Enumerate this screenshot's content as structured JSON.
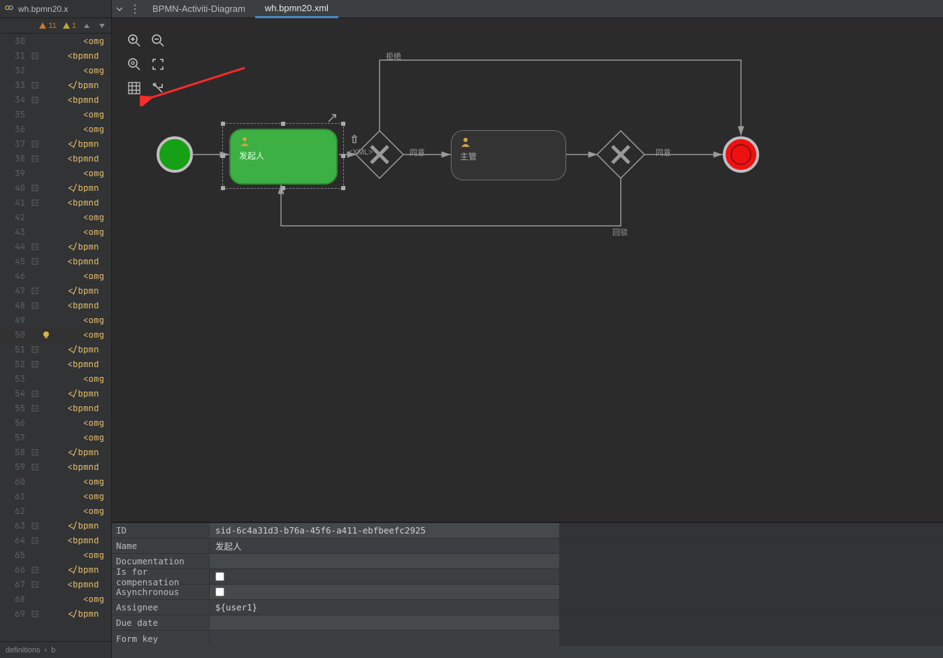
{
  "left_tab": {
    "label": "wh.bpmn20.x"
  },
  "warnings": {
    "major": "11",
    "minor": "1"
  },
  "code_lines": [
    {
      "n": "30",
      "fold": "",
      "txt_kind": "omg-close",
      "txt": "<omg"
    },
    {
      "n": "31",
      "fold": "-",
      "txt_kind": "bpmn-open",
      "txt": "<bpmnd"
    },
    {
      "n": "32",
      "fold": "",
      "txt_kind": "omg-open",
      "txt": "<omg"
    },
    {
      "n": "33",
      "fold": "-",
      "txt_kind": "bpmn-close",
      "txt": "</bpmn"
    },
    {
      "n": "34",
      "fold": "-",
      "txt_kind": "bpmn-open",
      "txt": "<bpmnd"
    },
    {
      "n": "35",
      "fold": "",
      "txt_kind": "omg-open",
      "txt": "<omg"
    },
    {
      "n": "36",
      "fold": "",
      "txt_kind": "omg-open",
      "txt": "<omg"
    },
    {
      "n": "37",
      "fold": "-",
      "txt_kind": "bpmn-close",
      "txt": "</bpmn"
    },
    {
      "n": "38",
      "fold": "-",
      "txt_kind": "bpmn-open",
      "txt": "<bpmnd"
    },
    {
      "n": "39",
      "fold": "",
      "txt_kind": "omg-open",
      "txt": "<omg"
    },
    {
      "n": "40",
      "fold": "-",
      "txt_kind": "bpmn-close",
      "txt": "</bpmn"
    },
    {
      "n": "41",
      "fold": "-",
      "txt_kind": "bpmn-open",
      "txt": "<bpmnd"
    },
    {
      "n": "42",
      "fold": "",
      "txt_kind": "omg-open",
      "txt": "<omg"
    },
    {
      "n": "43",
      "fold": "",
      "txt_kind": "omg-open",
      "txt": "<omg"
    },
    {
      "n": "44",
      "fold": "-",
      "txt_kind": "bpmn-close",
      "txt": "</bpmn"
    },
    {
      "n": "45",
      "fold": "-",
      "txt_kind": "bpmn-open",
      "txt": "<bpmnd"
    },
    {
      "n": "46",
      "fold": "",
      "txt_kind": "omg-open",
      "txt": "<omg"
    },
    {
      "n": "47",
      "fold": "-",
      "txt_kind": "bpmn-close",
      "txt": "</bpmn"
    },
    {
      "n": "48",
      "fold": "-",
      "txt_kind": "bpmn-open",
      "txt": "<bpmnd"
    },
    {
      "n": "49",
      "fold": "",
      "txt_kind": "omg-open",
      "txt": "<omg"
    },
    {
      "n": "50",
      "fold": "",
      "txt_kind": "omg-open",
      "txt": "<omg",
      "bulb": true,
      "hl": true
    },
    {
      "n": "51",
      "fold": "-",
      "txt_kind": "bpmn-close",
      "txt": "</bpmn"
    },
    {
      "n": "52",
      "fold": "-",
      "txt_kind": "bpmn-open",
      "txt": "<bpmnd"
    },
    {
      "n": "53",
      "fold": "",
      "txt_kind": "omg-open",
      "txt": "<omg"
    },
    {
      "n": "54",
      "fold": "-",
      "txt_kind": "bpmn-close",
      "txt": "</bpmn"
    },
    {
      "n": "55",
      "fold": "-",
      "txt_kind": "bpmn-open",
      "txt": "<bpmnd"
    },
    {
      "n": "56",
      "fold": "",
      "txt_kind": "omg-open",
      "txt": "<omg"
    },
    {
      "n": "57",
      "fold": "",
      "txt_kind": "omg-open",
      "txt": "<omg"
    },
    {
      "n": "58",
      "fold": "-",
      "txt_kind": "bpmn-close",
      "txt": "</bpmn"
    },
    {
      "n": "59",
      "fold": "-",
      "txt_kind": "bpmn-open",
      "txt": "<bpmnd"
    },
    {
      "n": "60",
      "fold": "",
      "txt_kind": "omg-open",
      "txt": "<omg"
    },
    {
      "n": "61",
      "fold": "",
      "txt_kind": "omg-open",
      "txt": "<omg"
    },
    {
      "n": "62",
      "fold": "",
      "txt_kind": "omg-open",
      "txt": "<omg"
    },
    {
      "n": "63",
      "fold": "-",
      "txt_kind": "bpmn-close",
      "txt": "</bpmn"
    },
    {
      "n": "64",
      "fold": "-",
      "txt_kind": "bpmn-open",
      "txt": "<bpmnd"
    },
    {
      "n": "65",
      "fold": "",
      "txt_kind": "omg-open",
      "txt": "<omg"
    },
    {
      "n": "66",
      "fold": "-",
      "txt_kind": "bpmn-close",
      "txt": "</bpmn"
    },
    {
      "n": "67",
      "fold": "-",
      "txt_kind": "bpmn-open",
      "txt": "<bpmnd"
    },
    {
      "n": "68",
      "fold": "",
      "txt_kind": "omg-open",
      "txt": "<omg"
    },
    {
      "n": "69",
      "fold": "-",
      "txt_kind": "bpmn-close",
      "txt": "</bpmn"
    }
  ],
  "breadcrumb": {
    "a": "definitions",
    "b": "b"
  },
  "tabs": {
    "diagram": "BPMN-Activiti-Diagram",
    "xml": "wh.bpmn20.xml"
  },
  "diagram": {
    "task1_label": "发起人",
    "task2_label": "主管",
    "xml_label": "<XML>",
    "edge_agree": "同意",
    "edge_agree2": "同意",
    "edge_reject": "拒绝",
    "edge_return": "回驳"
  },
  "props": {
    "id_label": "ID",
    "id_value": "sid-6c4a31d3-b76a-45f6-a411-ebfbeefc2925",
    "name_label": "Name",
    "name_value": "发起人",
    "doc_label": "Documentation",
    "comp_label": "Is for compensation",
    "async_label": "Asynchronous",
    "assignee_label": "Assignee",
    "assignee_value": "${user1}",
    "due_label": "Due date",
    "formkey_label": "Form key"
  }
}
